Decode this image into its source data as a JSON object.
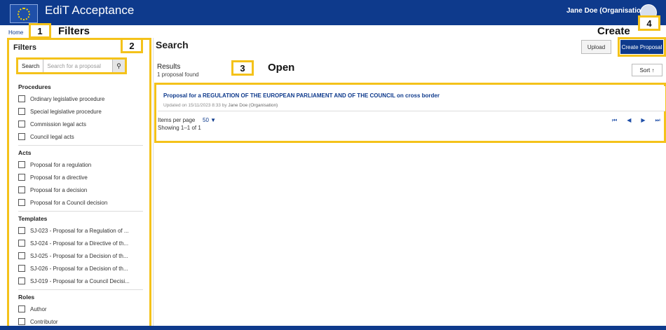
{
  "app": {
    "title": "EdiT Acceptance",
    "user": "Jane Doe (Organisation)"
  },
  "breadcrumb": {
    "home": "Home"
  },
  "filters": {
    "title": "Filters",
    "collapse_icon": "«",
    "search": {
      "label": "Search",
      "placeholder": "Search for a proposal"
    },
    "groups": [
      {
        "title": "Procedures",
        "items": [
          "Ordinary legislative procedure",
          "Special legislative procedure",
          "Commission legal acts",
          "Council legal acts"
        ]
      },
      {
        "title": "Acts",
        "items": [
          "Proposal for a regulation",
          "Proposal for a directive",
          "Proposal for a decision",
          "Proposal for a Council decision"
        ]
      },
      {
        "title": "Templates",
        "items": [
          "SJ-023 - Proposal for a Regulation of ...",
          "SJ-024 - Proposal for a Directive of th...",
          "SJ-025 - Proposal for a Decision of th...",
          "SJ-026 - Proposal for a Decision of th...",
          "SJ-019 - Proposal for a Council Decisi..."
        ]
      },
      {
        "title": "Roles",
        "items": [
          "Author",
          "Contributor"
        ]
      }
    ]
  },
  "main": {
    "heading": "Search",
    "results_label": "Results",
    "results_count": "1 proposal found",
    "sort_label": "Sort ↑",
    "upload_label": "Upload",
    "create_label": "Create Proposal",
    "proposal": {
      "title": "Proposal for a REGULATION OF THE EUROPEAN PARLIAMENT AND OF THE COUNCIL on cross border",
      "updated": "Updated on 15/11/2023 8:33 by",
      "author": "Jane Doe (Organisation)"
    },
    "items_per_page_label": "Items per page",
    "items_per_page_value": "50 ▼",
    "showing": "Showing 1–1 of 1",
    "pager": [
      "⏮",
      "◀",
      "▶",
      "⏭"
    ]
  },
  "callouts": [
    {
      "number": "1",
      "label": "Filters"
    },
    {
      "number": "2",
      "label": "Search"
    },
    {
      "number": "3",
      "label": "Open"
    },
    {
      "number": "4",
      "label": "Create"
    }
  ],
  "colors": {
    "brand": "#0e3a8c",
    "highlight": "#f4c21a"
  }
}
